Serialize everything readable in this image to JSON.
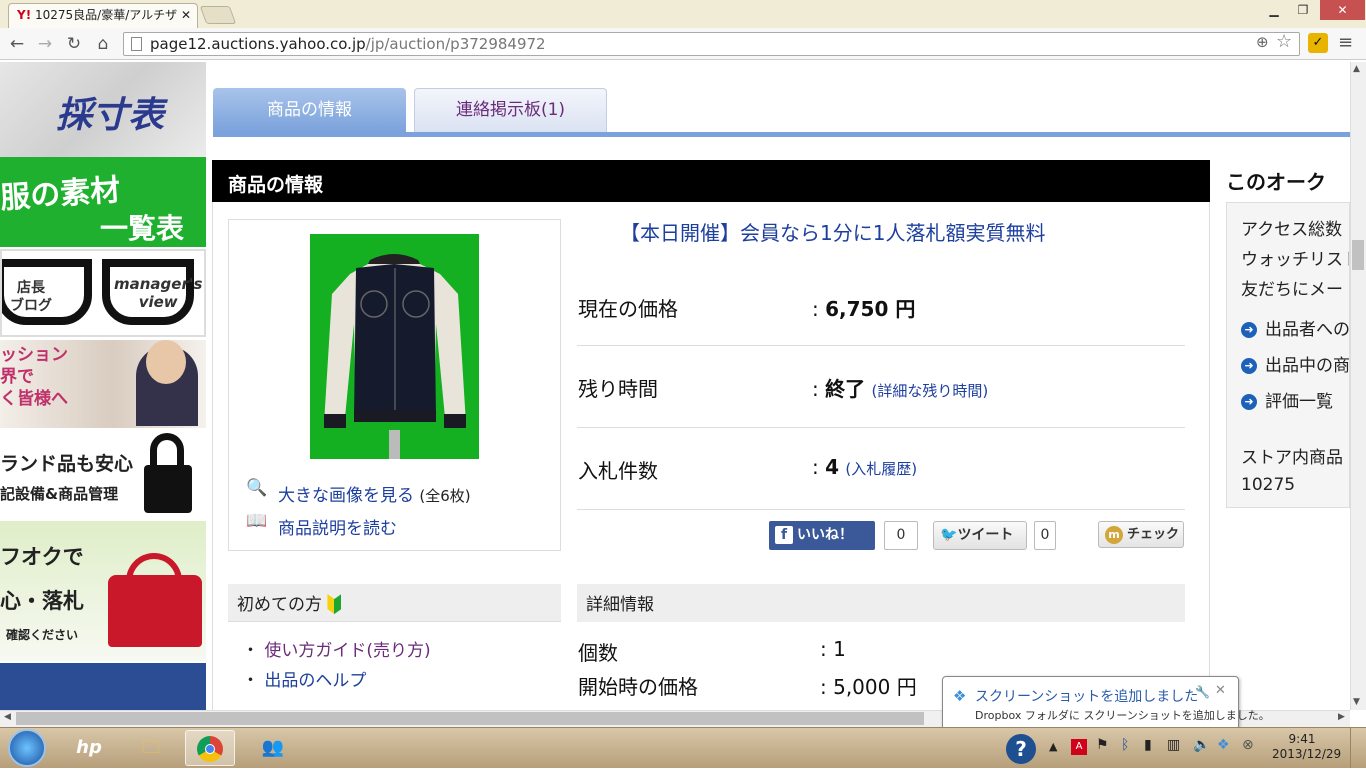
{
  "browser": {
    "tab_title": "10275良品/豪華/アルチザ",
    "tab_favicon": "Y!",
    "url_host": "page12.auctions.yahoo.co.jp",
    "url_path": "/jp/auction/p372984972"
  },
  "left_banners": {
    "saisun": "採寸表",
    "fuku_line1": "服の素材",
    "fuku_line2": "一覧表",
    "blog_left": "店長\nブログ",
    "blog_right": "manager's\nview",
    "fashion_line1": "ッション",
    "fashion_line2": "界で",
    "fashion_line3": "く皆様へ",
    "brand_line1": "ランド品も安心",
    "brand_line2": "記設備&商品管理",
    "yafuoku_line1": "フオクで",
    "yafuoku_line2": "心・落札",
    "yafuoku_line3": "確認ください"
  },
  "tabs": {
    "info": "商品の情報",
    "board": "連絡掲示板(1)"
  },
  "section_title": "商品の情報",
  "image_links": {
    "large": "大きな画像を見る",
    "large_count": "(全6枚)",
    "description": "商品説明を読む"
  },
  "promo": "【本日開催】会員なら1分に1人落札額実質無料",
  "price": {
    "label": "現在の価格",
    "value": "6,750 円"
  },
  "remaining": {
    "label": "残り時間",
    "value": "終了",
    "detail_link": "(詳細な残り時間)"
  },
  "bids": {
    "label": "入札件数",
    "value": "4",
    "history_link": "(入札履歴)"
  },
  "social": {
    "like": "いいね！",
    "like_count": "0",
    "tweet": "ツイート",
    "tweet_count": "0",
    "check": "チェック"
  },
  "beginner": {
    "title": "初めての方",
    "guide": "使い方ガイド(売り方)",
    "help": "出品のヘルプ"
  },
  "details": {
    "title": "詳細情報",
    "qty_label": "個数",
    "qty_value": ": 1",
    "start_label": "開始時の価格",
    "start_value": ": 5,000 円"
  },
  "right_panel": {
    "title": "このオーク",
    "access": "アクセス総数",
    "watch": "ウォッチリスト",
    "friends": "友だちにメー",
    "seller": "出品者への",
    "selling": "出品中の商",
    "ratings": "評価一覧",
    "store": "ストア内商品",
    "store_code": "10275"
  },
  "balloon": {
    "title": "スクリーンショットを追加しました",
    "body": "Dropbox フォルダに スクリーンショットを追加しました。"
  },
  "taskbar": {
    "time": "9:41",
    "date": "2013/12/29"
  },
  "colors": {
    "tab_active": "#7ba2dc",
    "link": "#1d3f9e",
    "facebook": "#3b5998"
  }
}
